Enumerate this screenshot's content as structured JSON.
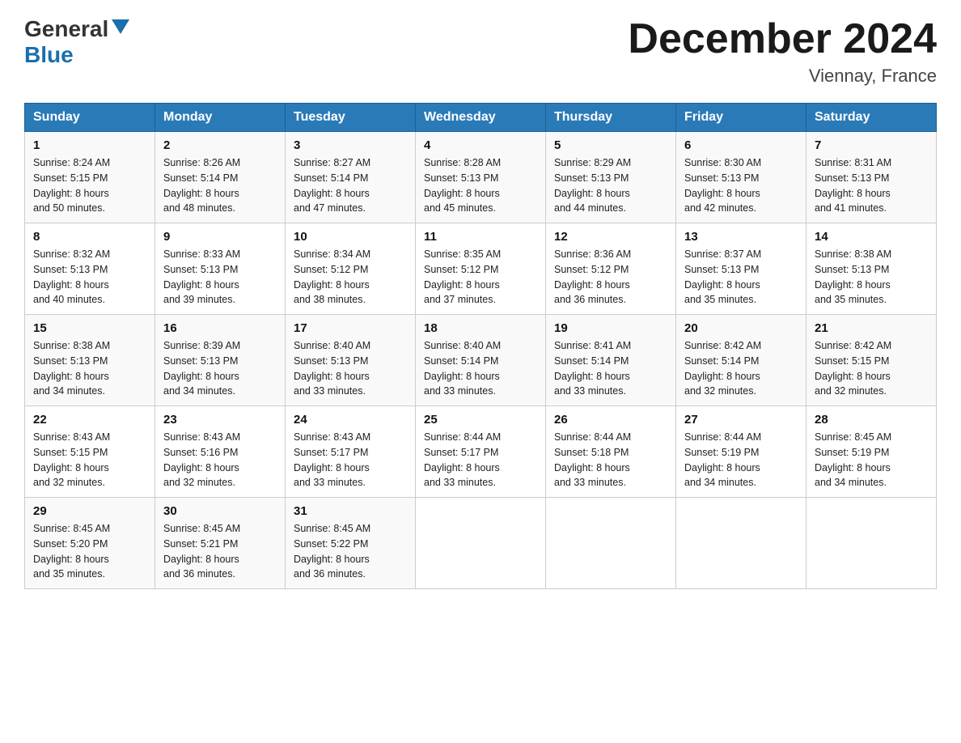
{
  "header": {
    "logo_general": "General",
    "logo_blue": "Blue",
    "month_title": "December 2024",
    "location": "Viennay, France"
  },
  "days_of_week": [
    "Sunday",
    "Monday",
    "Tuesday",
    "Wednesday",
    "Thursday",
    "Friday",
    "Saturday"
  ],
  "weeks": [
    [
      {
        "day": "1",
        "sunrise": "8:24 AM",
        "sunset": "5:15 PM",
        "daylight": "8 hours and 50 minutes."
      },
      {
        "day": "2",
        "sunrise": "8:26 AM",
        "sunset": "5:14 PM",
        "daylight": "8 hours and 48 minutes."
      },
      {
        "day": "3",
        "sunrise": "8:27 AM",
        "sunset": "5:14 PM",
        "daylight": "8 hours and 47 minutes."
      },
      {
        "day": "4",
        "sunrise": "8:28 AM",
        "sunset": "5:13 PM",
        "daylight": "8 hours and 45 minutes."
      },
      {
        "day": "5",
        "sunrise": "8:29 AM",
        "sunset": "5:13 PM",
        "daylight": "8 hours and 44 minutes."
      },
      {
        "day": "6",
        "sunrise": "8:30 AM",
        "sunset": "5:13 PM",
        "daylight": "8 hours and 42 minutes."
      },
      {
        "day": "7",
        "sunrise": "8:31 AM",
        "sunset": "5:13 PM",
        "daylight": "8 hours and 41 minutes."
      }
    ],
    [
      {
        "day": "8",
        "sunrise": "8:32 AM",
        "sunset": "5:13 PM",
        "daylight": "8 hours and 40 minutes."
      },
      {
        "day": "9",
        "sunrise": "8:33 AM",
        "sunset": "5:13 PM",
        "daylight": "8 hours and 39 minutes."
      },
      {
        "day": "10",
        "sunrise": "8:34 AM",
        "sunset": "5:12 PM",
        "daylight": "8 hours and 38 minutes."
      },
      {
        "day": "11",
        "sunrise": "8:35 AM",
        "sunset": "5:12 PM",
        "daylight": "8 hours and 37 minutes."
      },
      {
        "day": "12",
        "sunrise": "8:36 AM",
        "sunset": "5:12 PM",
        "daylight": "8 hours and 36 minutes."
      },
      {
        "day": "13",
        "sunrise": "8:37 AM",
        "sunset": "5:13 PM",
        "daylight": "8 hours and 35 minutes."
      },
      {
        "day": "14",
        "sunrise": "8:38 AM",
        "sunset": "5:13 PM",
        "daylight": "8 hours and 35 minutes."
      }
    ],
    [
      {
        "day": "15",
        "sunrise": "8:38 AM",
        "sunset": "5:13 PM",
        "daylight": "8 hours and 34 minutes."
      },
      {
        "day": "16",
        "sunrise": "8:39 AM",
        "sunset": "5:13 PM",
        "daylight": "8 hours and 34 minutes."
      },
      {
        "day": "17",
        "sunrise": "8:40 AM",
        "sunset": "5:13 PM",
        "daylight": "8 hours and 33 minutes."
      },
      {
        "day": "18",
        "sunrise": "8:40 AM",
        "sunset": "5:14 PM",
        "daylight": "8 hours and 33 minutes."
      },
      {
        "day": "19",
        "sunrise": "8:41 AM",
        "sunset": "5:14 PM",
        "daylight": "8 hours and 33 minutes."
      },
      {
        "day": "20",
        "sunrise": "8:42 AM",
        "sunset": "5:14 PM",
        "daylight": "8 hours and 32 minutes."
      },
      {
        "day": "21",
        "sunrise": "8:42 AM",
        "sunset": "5:15 PM",
        "daylight": "8 hours and 32 minutes."
      }
    ],
    [
      {
        "day": "22",
        "sunrise": "8:43 AM",
        "sunset": "5:15 PM",
        "daylight": "8 hours and 32 minutes."
      },
      {
        "day": "23",
        "sunrise": "8:43 AM",
        "sunset": "5:16 PM",
        "daylight": "8 hours and 32 minutes."
      },
      {
        "day": "24",
        "sunrise": "8:43 AM",
        "sunset": "5:17 PM",
        "daylight": "8 hours and 33 minutes."
      },
      {
        "day": "25",
        "sunrise": "8:44 AM",
        "sunset": "5:17 PM",
        "daylight": "8 hours and 33 minutes."
      },
      {
        "day": "26",
        "sunrise": "8:44 AM",
        "sunset": "5:18 PM",
        "daylight": "8 hours and 33 minutes."
      },
      {
        "day": "27",
        "sunrise": "8:44 AM",
        "sunset": "5:19 PM",
        "daylight": "8 hours and 34 minutes."
      },
      {
        "day": "28",
        "sunrise": "8:45 AM",
        "sunset": "5:19 PM",
        "daylight": "8 hours and 34 minutes."
      }
    ],
    [
      {
        "day": "29",
        "sunrise": "8:45 AM",
        "sunset": "5:20 PM",
        "daylight": "8 hours and 35 minutes."
      },
      {
        "day": "30",
        "sunrise": "8:45 AM",
        "sunset": "5:21 PM",
        "daylight": "8 hours and 36 minutes."
      },
      {
        "day": "31",
        "sunrise": "8:45 AM",
        "sunset": "5:22 PM",
        "daylight": "8 hours and 36 minutes."
      },
      null,
      null,
      null,
      null
    ]
  ],
  "labels": {
    "sunrise": "Sunrise:",
    "sunset": "Sunset:",
    "daylight": "Daylight:"
  }
}
